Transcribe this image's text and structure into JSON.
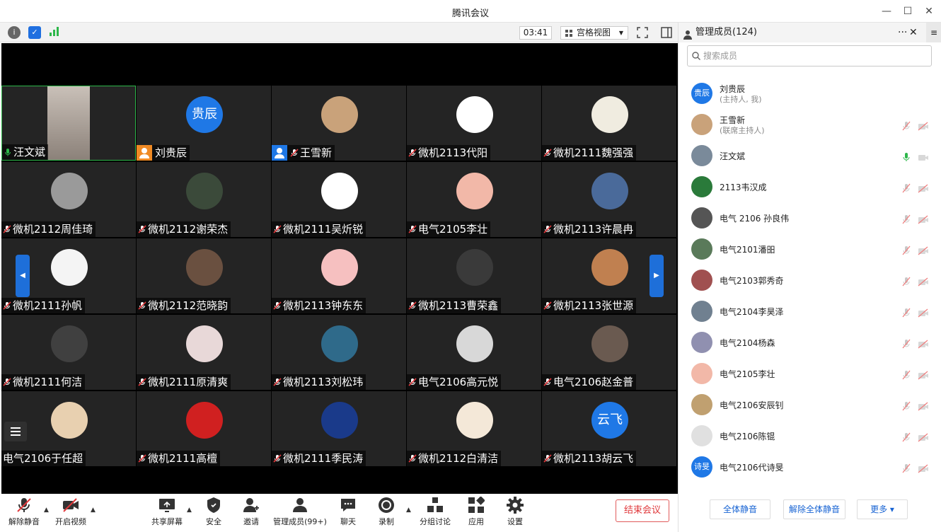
{
  "window": {
    "title": "腾讯会议"
  },
  "toolbar": {
    "timer": "03:41",
    "view_label": "宫格视图"
  },
  "tiles": [
    {
      "name": "汪文斌",
      "mic": "on",
      "avatar_color": "#5a5550",
      "video": true
    },
    {
      "name": "刘贵辰",
      "avatar_text": "贵辰",
      "avatar_color": "#1f78e6",
      "host": true
    },
    {
      "name": "王雪新",
      "avatar_color": "#c9a27a",
      "cohost": true
    },
    {
      "name": "微机2113代阳",
      "avatar_color": "#ffffff"
    },
    {
      "name": "微机2111魏强强",
      "avatar_color": "#f0ece0"
    },
    {
      "name": "微机2112周佳琦",
      "avatar_color": "#9a9a9a"
    },
    {
      "name": "微机2112谢荣杰",
      "avatar_color": "#3b4a3a"
    },
    {
      "name": "微机2111吴炘锐",
      "avatar_color": "#ffffff"
    },
    {
      "name": "电气2105李壮",
      "avatar_color": "#f2b8a8"
    },
    {
      "name": "微机2113许晨冉",
      "avatar_color": "#4a6a9a"
    },
    {
      "name": "微机2111孙帆",
      "avatar_color": "#f4f4f4"
    },
    {
      "name": "微机2112范晓韵",
      "avatar_color": "#6a5040"
    },
    {
      "name": "微机2113钟东东",
      "avatar_color": "#f6c0c0"
    },
    {
      "name": "微机2113曹荣鑫",
      "avatar_color": "#3a3a3a"
    },
    {
      "name": "微机2113张世源",
      "avatar_color": "#c08050"
    },
    {
      "name": "微机2111何洁",
      "avatar_color": "#404040"
    },
    {
      "name": "微机2111原清爽",
      "avatar_color": "#e8d8d8"
    },
    {
      "name": "微机2113刘松玮",
      "avatar_color": "#2f6a8a"
    },
    {
      "name": "电气2106高元悦",
      "avatar_color": "#d8d8d8"
    },
    {
      "name": "电气2106赵金普",
      "avatar_color": "#6a5a50"
    },
    {
      "name": "电气2106于任超",
      "avatar_color": "#e8d0b0",
      "no_mic_icon": true
    },
    {
      "name": "微机2111高檀",
      "avatar_color": "#d02020"
    },
    {
      "name": "微机2111季民涛",
      "avatar_color": "#1a3a8a"
    },
    {
      "name": "微机2112白清洁",
      "avatar_color": "#f4e8d8"
    },
    {
      "name": "微机2113胡云飞",
      "avatar_text": "云飞",
      "avatar_color": "#1f78e6"
    }
  ],
  "bottombar": {
    "unmute": "解除静音",
    "start_video": "开启视频",
    "share_screen": "共享屏幕",
    "security": "安全",
    "invite": "邀请",
    "manage_members": "管理成员(99+)",
    "chat": "聊天",
    "record": "录制",
    "breakout": "分组讨论",
    "apps": "应用",
    "settings": "设置",
    "end_meeting": "结束会议"
  },
  "panel": {
    "title": "管理成员(124)",
    "search_placeholder": "搜索成员",
    "members": [
      {
        "name": "刘贵辰",
        "role": "(主持人, 我)",
        "avatar_text": "贵辰",
        "avatar_color": "#1f78e6"
      },
      {
        "name": "王雪新",
        "role": "(联席主持人)",
        "avatar_color": "#c9a27a",
        "icons": true,
        "mic_muted": true
      },
      {
        "name": "汪文斌",
        "avatar_color": "#7a8a9a",
        "icons": true,
        "mic_on": true
      },
      {
        "name": "2113韦汉成",
        "avatar_color": "#2a7a3a",
        "icons": true,
        "mic_muted": true
      },
      {
        "name": "电气 2106 孙良伟",
        "avatar_color": "#555555",
        "icons": true,
        "mic_muted": true
      },
      {
        "name": "电气2101潘昍",
        "avatar_color": "#5a7a5a",
        "icons": true,
        "mic_muted": true
      },
      {
        "name": "电气2103郭秀奇",
        "avatar_color": "#a05050",
        "icons": true,
        "mic_muted": true
      },
      {
        "name": "电气2104李昊泽",
        "avatar_color": "#708090",
        "icons": true,
        "mic_muted": true
      },
      {
        "name": "电气2104杨森",
        "avatar_color": "#9090b0",
        "icons": true,
        "mic_muted": true
      },
      {
        "name": "电气2105李壮",
        "avatar_color": "#f2b8a8",
        "icons": true,
        "mic_muted": true
      },
      {
        "name": "电气2106安辰钊",
        "avatar_color": "#c0a070",
        "icons": true,
        "mic_muted": true
      },
      {
        "name": "电气2106陈锟",
        "avatar_color": "#e0e0e0",
        "icons": true,
        "mic_muted": true
      },
      {
        "name": "电气2106代诗旻",
        "avatar_text": "诗旻",
        "avatar_color": "#1f78e6",
        "icons": true,
        "mic_muted": true
      }
    ],
    "mute_all": "全体静音",
    "unmute_all": "解除全体静音",
    "more": "更多"
  }
}
